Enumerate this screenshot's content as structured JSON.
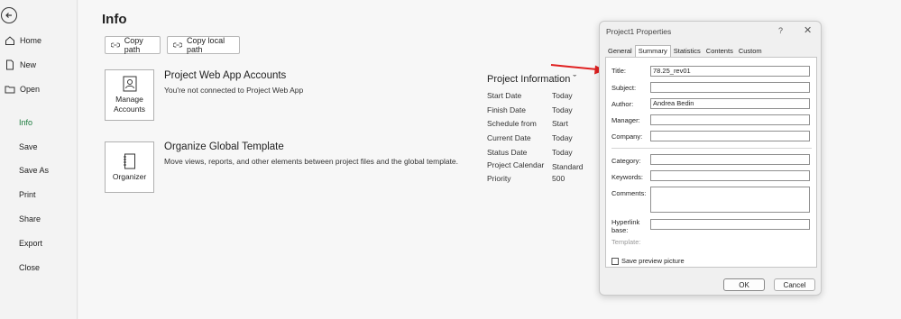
{
  "sidebar": {
    "items": [
      {
        "label": "Home",
        "icon": "home-icon"
      },
      {
        "label": "New",
        "icon": "new-file-icon"
      },
      {
        "label": "Open",
        "icon": "folder-icon"
      },
      {
        "label": "Info"
      },
      {
        "label": "Save"
      },
      {
        "label": "Save As"
      },
      {
        "label": "Print"
      },
      {
        "label": "Share"
      },
      {
        "label": "Export"
      },
      {
        "label": "Close"
      }
    ]
  },
  "main": {
    "title": "Info",
    "copy_path": "Copy path",
    "copy_local_path": "Copy local path",
    "pwa": {
      "tile_label_1": "Manage",
      "tile_label_2": "Accounts",
      "title": "Project Web App Accounts",
      "desc": "You're not connected to Project Web App"
    },
    "ogt": {
      "tile_label": "Organizer",
      "title": "Organize Global Template",
      "desc": "Move views, reports, and other elements between project files and the global template."
    },
    "project_info": {
      "title": "Project Information ˇ",
      "rows": [
        {
          "label": "Start Date",
          "value": "Today"
        },
        {
          "label": "Finish Date",
          "value": "Today"
        },
        {
          "label": "Schedule from",
          "value": "Start"
        },
        {
          "label": "Current Date",
          "value": "Today"
        },
        {
          "label": "Status Date",
          "value": "Today"
        },
        {
          "label": "Project Calendar",
          "value": "Standard"
        },
        {
          "label": "Priority",
          "value": "500"
        }
      ]
    }
  },
  "dialog": {
    "title": "Project1 Properties",
    "help": "?",
    "close": "✕",
    "tabs": [
      "General",
      "Summary",
      "Statistics",
      "Contents",
      "Custom"
    ],
    "fields": {
      "title_label": "Title:",
      "title_value": "78.25_rev01",
      "subject_label": "Subject:",
      "subject_value": "",
      "author_label": "Author:",
      "author_value": "Andrea Bedin",
      "manager_label": "Manager:",
      "manager_value": "",
      "company_label": "Company:",
      "company_value": "",
      "category_label": "Category:",
      "category_value": "",
      "keywords_label": "Keywords:",
      "keywords_value": "",
      "comments_label": "Comments:",
      "comments_value": "",
      "hyperlink_label_1": "Hyperlink",
      "hyperlink_label_2": "base:",
      "hyperlink_value": "",
      "template_label": "Template:"
    },
    "save_preview": "Save preview picture",
    "ok": "OK",
    "cancel": "Cancel"
  },
  "colors": {
    "arrow": "#e02020",
    "active_nav": "#1a7a3c"
  }
}
